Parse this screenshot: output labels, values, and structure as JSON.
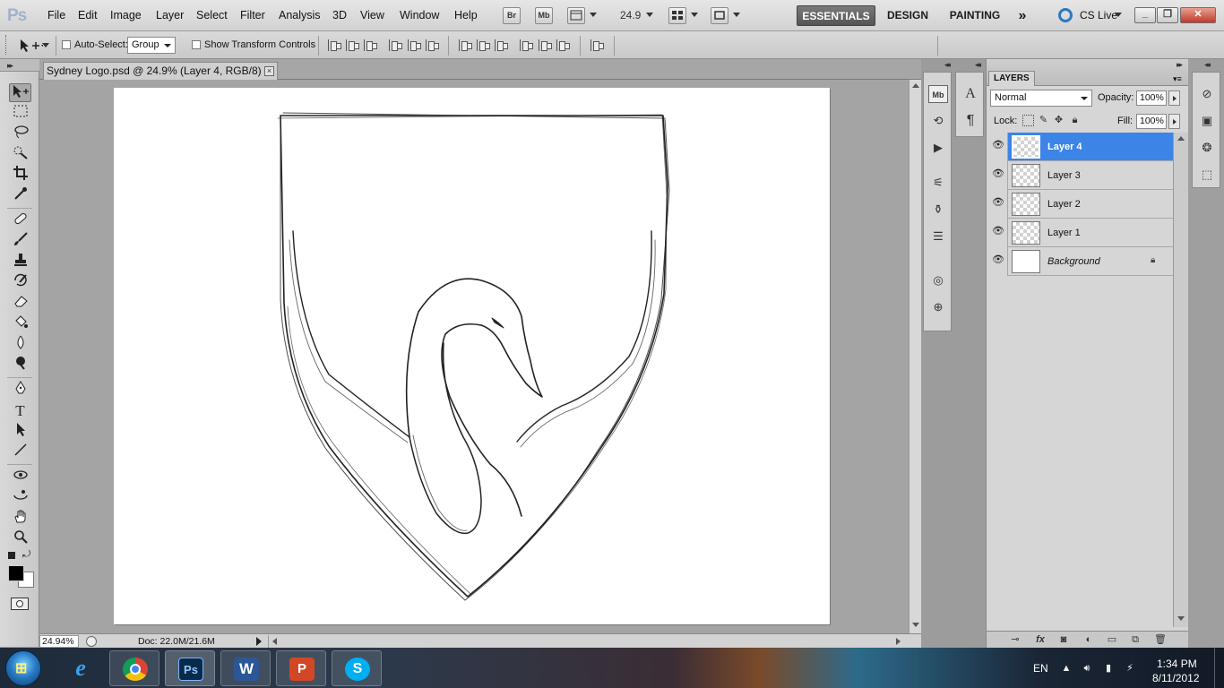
{
  "app": {
    "logo": "Ps"
  },
  "menu": [
    "File",
    "Edit",
    "Image",
    "Layer",
    "Select",
    "Filter",
    "Analysis",
    "3D",
    "View",
    "Window",
    "Help"
  ],
  "menubar": {
    "bridge_label": "Br",
    "minibridge_label": "Mb",
    "zoom": "24.9",
    "workspaces": [
      "ESSENTIALS",
      "DESIGN",
      "PAINTING"
    ],
    "more": "»",
    "cs_live": "CS Live"
  },
  "options": {
    "auto_select_label": "Auto-Select:",
    "auto_select_value": "Group",
    "transform_label": "Show Transform Controls"
  },
  "document": {
    "tab_title": "Sydney Logo.psd @ 24.9% (Layer 4, RGB/8) *",
    "close_symbol": "×",
    "zoom_status": "24.94%",
    "doc_info": "Doc: 22.0M/21.6M"
  },
  "layers_panel": {
    "tab": "LAYERS",
    "blend_mode": "Normal",
    "opacity_label": "Opacity:",
    "opacity": "100%",
    "lock_label": "Lock:",
    "fill_label": "Fill:",
    "fill": "100%",
    "layers": [
      {
        "name": "Layer 4",
        "selected": true
      },
      {
        "name": "Layer 3",
        "selected": false
      },
      {
        "name": "Layer 2",
        "selected": false
      },
      {
        "name": "Layer 1",
        "selected": false
      },
      {
        "name": "Background",
        "selected": false
      }
    ]
  },
  "taskbar": {
    "language": "EN",
    "time": "1:34 PM",
    "date": "8/11/2012",
    "apps": [
      "windows-start",
      "internet-explorer",
      "chrome",
      "photoshop",
      "word",
      "powerpoint",
      "skype"
    ]
  },
  "colors": {
    "selection_blue": "#3c84e5",
    "ui_gray": "#d6d6d6",
    "foreground": "#000000",
    "background": "#ffffff"
  },
  "icons": {
    "tools": [
      "move-tool",
      "marquee-tool",
      "lasso-tool",
      "quick-selection-tool",
      "crop-tool",
      "eyedropper-tool",
      "spot-healing-tool",
      "brush-tool",
      "clone-stamp-tool",
      "history-brush-tool",
      "eraser-tool",
      "paint-bucket-tool",
      "blur-tool",
      "dodge-tool",
      "pen-tool",
      "type-tool",
      "path-selection-tool",
      "line-tool",
      "3d-rotate-tool",
      "3d-orbit-tool",
      "hand-tool",
      "zoom-tool"
    ]
  }
}
